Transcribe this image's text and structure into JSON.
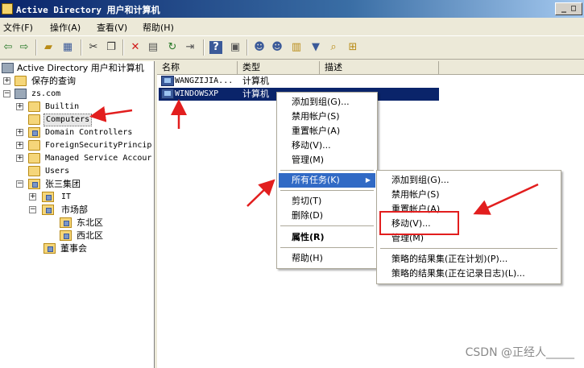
{
  "window": {
    "title": "Active Directory 用户和计算机",
    "buttons": "_ □"
  },
  "menubar": [
    {
      "label": "文件(F)"
    },
    {
      "label": "操作(A)"
    },
    {
      "label": "查看(V)"
    },
    {
      "label": "帮助(H)"
    }
  ],
  "toolbar_icons": [
    "back-arrow-icon",
    "forward-arrow-icon",
    "up-folder-icon",
    "show-tree-icon",
    "cut-icon",
    "copy-icon",
    "delete-icon",
    "properties-icon",
    "refresh-icon",
    "export-list-icon",
    "help-icon",
    "console-icon",
    "new-user-icon",
    "new-group-icon",
    "new-ou-icon",
    "filter-icon",
    "find-icon",
    "add-to-group-icon"
  ],
  "tree": {
    "root": "Active Directory 用户和计算机",
    "items": [
      {
        "label": "保存的查询"
      },
      {
        "label": "zs.com"
      },
      {
        "label": "Builtin"
      },
      {
        "label": "Computers"
      },
      {
        "label": "Domain Controllers"
      },
      {
        "label": "ForeignSecurityPrincip"
      },
      {
        "label": "Managed Service Accour"
      },
      {
        "label": "Users"
      },
      {
        "label": "张三集团"
      },
      {
        "label": "IT"
      },
      {
        "label": "市场部"
      },
      {
        "label": "东北区"
      },
      {
        "label": "西北区"
      },
      {
        "label": "董事会"
      }
    ]
  },
  "list": {
    "columns": [
      "名称",
      "类型",
      "描述"
    ],
    "rows": [
      {
        "name": "WANGZIJIA...",
        "type": "计算机"
      },
      {
        "name": "WINDOWSXP",
        "type": "计算机"
      }
    ]
  },
  "context_menu": {
    "items": [
      "添加到组(G)...",
      "禁用帐户(S)",
      "重置帐户(A)",
      "移动(V)...",
      "管理(M)",
      "所有任务(K)",
      "剪切(T)",
      "删除(D)",
      "属性(R)",
      "帮助(H)"
    ]
  },
  "submenu": {
    "items": [
      "添加到组(G)...",
      "禁用帐户(S)",
      "重置帐户(A)",
      "移动(V)...",
      "管理(M)",
      "策略的结果集(正在计划)(P)...",
      "策略的结果集(正在记录日志)(L)..."
    ]
  },
  "annotation_color": "#e21e1e",
  "watermark": "CSDN @正经人_____"
}
